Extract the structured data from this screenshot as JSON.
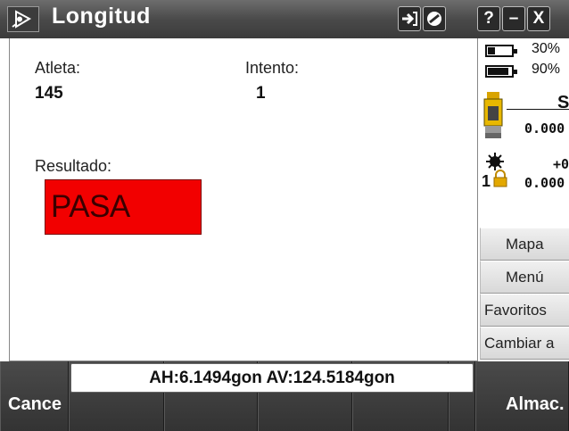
{
  "window": {
    "title": "Longitud",
    "buttons": [
      "?",
      "–",
      "X"
    ]
  },
  "main": {
    "athlete_label": "Atleta:",
    "athlete_value": "145",
    "attempt_label": "Intento:",
    "attempt_value": "1",
    "result_label": "Resultado:",
    "result_value": "PASA",
    "result_color": "#f20000"
  },
  "status": {
    "battery1_pct": "30%",
    "battery2_pct": "90%",
    "battery1_level": 0.3,
    "battery2_level": 0.9,
    "instrument_letter": "S",
    "instrument_value": "0.000",
    "target_value_top": "+0",
    "target_value": "0.000",
    "target_number": "1"
  },
  "side_menu": [
    "Mapa",
    "Menú",
    "Favoritos",
    "Cambiar a"
  ],
  "bottom": {
    "left_label": "Cance",
    "right_label": "Almac.",
    "angles_text": "AH:6.1494gon  AV:124.5184gon"
  }
}
